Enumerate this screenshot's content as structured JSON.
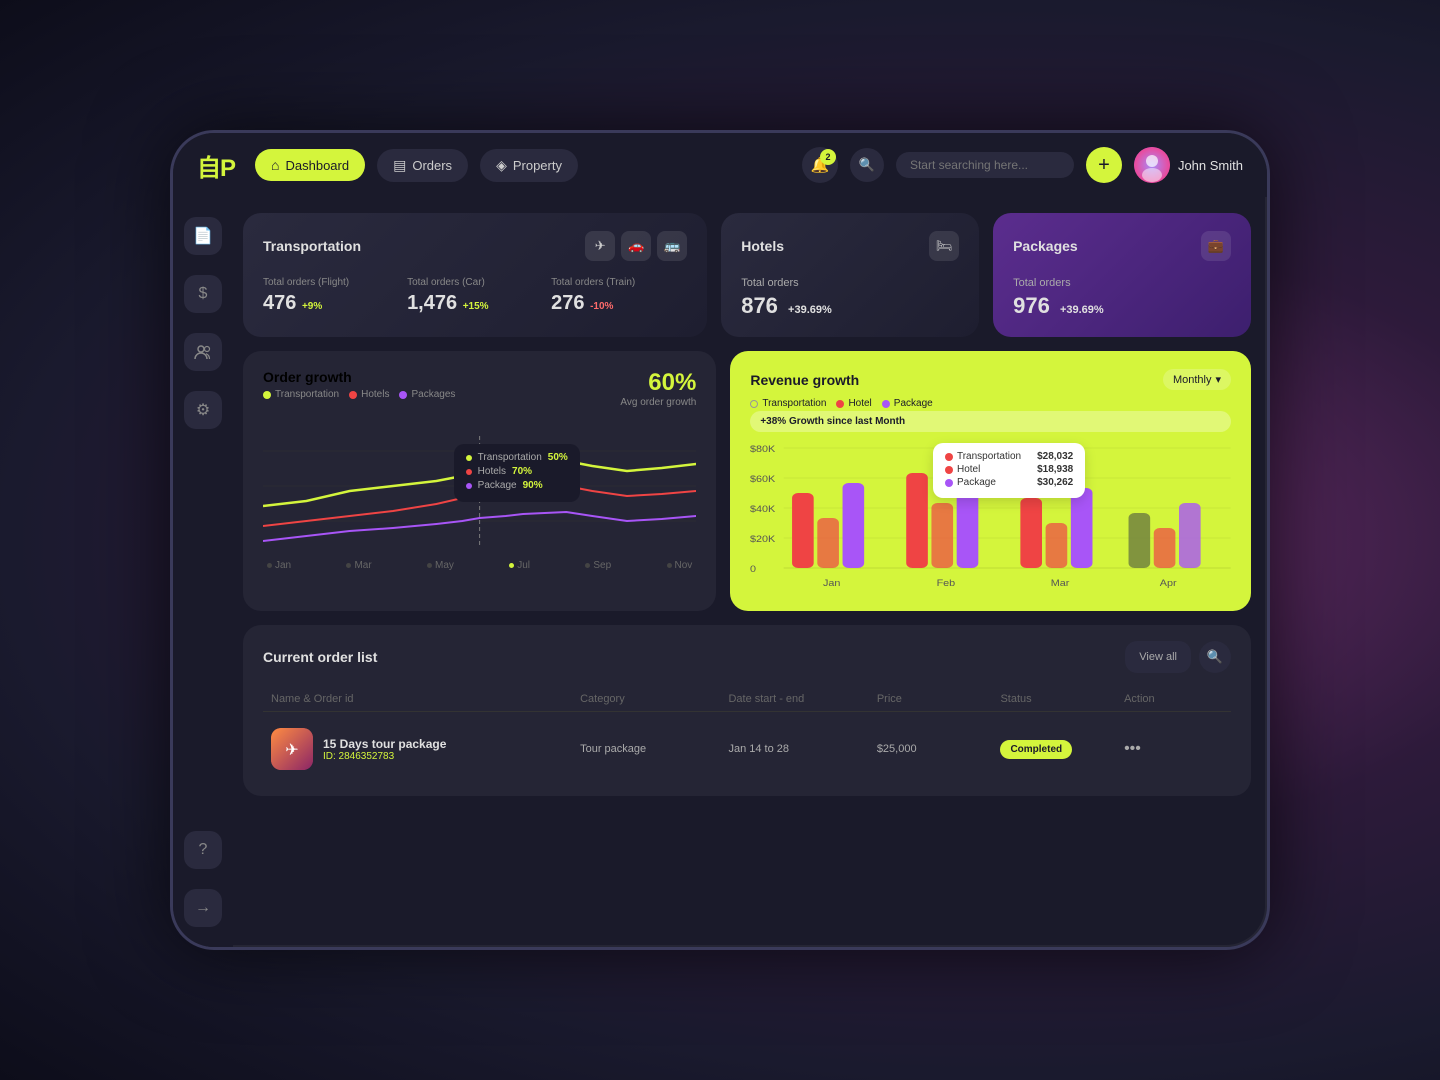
{
  "app": {
    "logo": "⟵P",
    "nav": {
      "dashboard": "Dashboard",
      "orders": "Orders",
      "property": "Property"
    },
    "search_placeholder": "Start searching here...",
    "notification_count": "2",
    "user_name": "John Smith"
  },
  "sidebar_icons": {
    "document": "📄",
    "dollar": "$",
    "users": "👥",
    "settings": "⚙",
    "help": "?",
    "logout": "→"
  },
  "transportation": {
    "title": "Transportation",
    "flight_label": "Total orders (Flight)",
    "flight_value": "476",
    "flight_change": "+9%",
    "car_label": "Total orders (Car)",
    "car_value": "1,476",
    "car_change": "+15%",
    "train_label": "Total orders (Train)",
    "train_value": "276",
    "train_change": "-10%"
  },
  "hotels": {
    "title": "Hotels",
    "label": "Total orders",
    "value": "876",
    "change": "+39.69%"
  },
  "packages": {
    "title": "Packages",
    "label": "Total orders",
    "value": "976",
    "change": "+39.69%"
  },
  "order_growth": {
    "title": "Order growth",
    "avg_percent": "60%",
    "avg_label": "Avg order growth",
    "legend": [
      "Transportation",
      "Hotels",
      "Packages"
    ],
    "months": [
      "Jan",
      "Mar",
      "May",
      "Jul",
      "Sep",
      "Nov"
    ],
    "tooltip": {
      "transportation_pct": "50%",
      "hotels_pct": "70%",
      "package_pct": "90%"
    }
  },
  "revenue_growth": {
    "title": "Revenue growth",
    "period": "Monthly",
    "badge": "+38% Growth since last Month",
    "legend": [
      "Transportation",
      "Hotel",
      "Package"
    ],
    "y_axis": [
      "$80K",
      "$60K",
      "$40K",
      "$20K",
      "0"
    ],
    "x_axis": [
      "Jan",
      "Feb",
      "Mar",
      "Apr"
    ],
    "tooltip": {
      "transportation_label": "Transportation",
      "transportation_val": "$28,032",
      "hotel_label": "Hotel",
      "hotel_val": "$18,938",
      "package_label": "Package",
      "package_val": "$30,262"
    }
  },
  "order_list": {
    "title": "Current order list",
    "view_all": "View all",
    "columns": [
      "Name & Order id",
      "Category",
      "Date start - end",
      "Price",
      "Status",
      "Action"
    ],
    "rows": [
      {
        "name": "15 Days tour package",
        "id": "ID: 2846352783",
        "category": "Tour package",
        "date": "Jan 14 to 28",
        "price": "$25,000",
        "status": "Completed"
      }
    ]
  }
}
